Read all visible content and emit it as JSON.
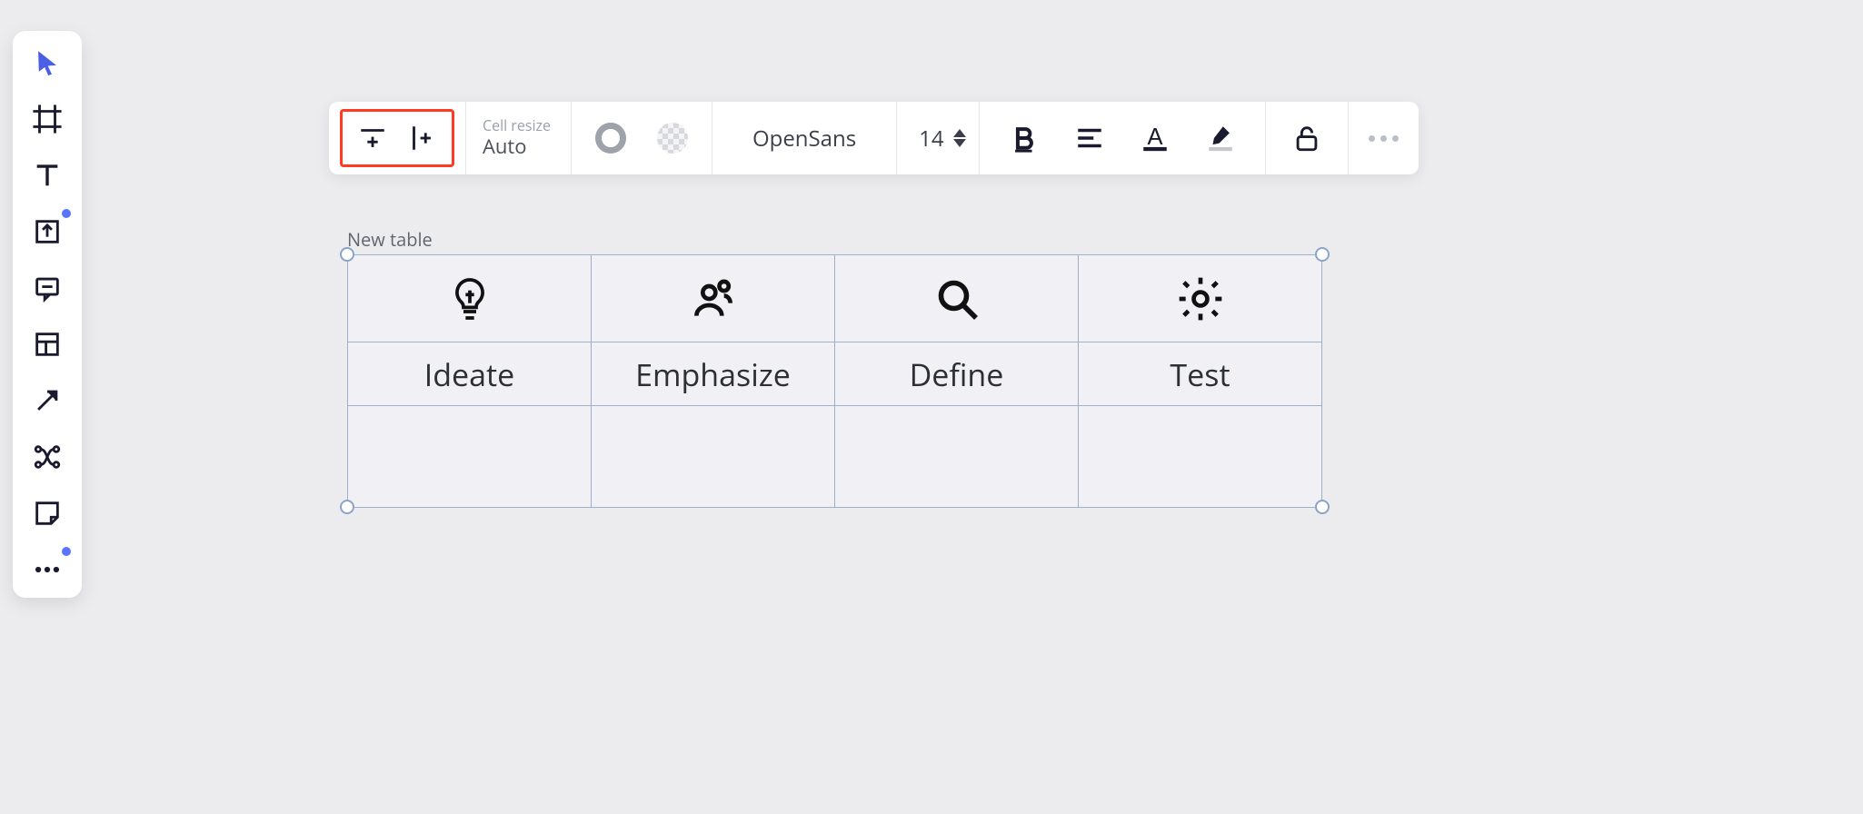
{
  "left_toolbar": {
    "items": [
      {
        "name": "pointer-tool",
        "icon": "pointer"
      },
      {
        "name": "frame-tool",
        "icon": "frame"
      },
      {
        "name": "text-tool",
        "icon": "text"
      },
      {
        "name": "upload-tool",
        "icon": "upload",
        "has_dot": true
      },
      {
        "name": "comment-tool",
        "icon": "comment"
      },
      {
        "name": "table-tool",
        "icon": "table"
      },
      {
        "name": "arrow-tool",
        "icon": "arrow"
      },
      {
        "name": "connector-tool",
        "icon": "connector"
      },
      {
        "name": "sticky-note-tool",
        "icon": "sticky"
      },
      {
        "name": "more-tools",
        "icon": "more",
        "has_dot": true
      }
    ]
  },
  "context_toolbar": {
    "insert_row_label": "Insert row",
    "insert_col_label": "Insert column",
    "cell_resize_label": "Cell resize",
    "cell_resize_value": "Auto",
    "border_color": "#9da2ab",
    "fill_color": "transparent",
    "font_name": "OpenSans",
    "font_size": "14",
    "bold_label": "B",
    "align_label": "Align",
    "text_color_label": "A",
    "highlight_label": "Highlight",
    "lock_label": "Unlock",
    "more_label": "More"
  },
  "canvas": {
    "table_label": "New table",
    "columns": [
      {
        "icon": "lightbulb",
        "label": "Ideate"
      },
      {
        "icon": "people",
        "label": "Emphasize"
      },
      {
        "icon": "magnify",
        "label": "Define"
      },
      {
        "icon": "gear",
        "label": "Test"
      }
    ]
  }
}
